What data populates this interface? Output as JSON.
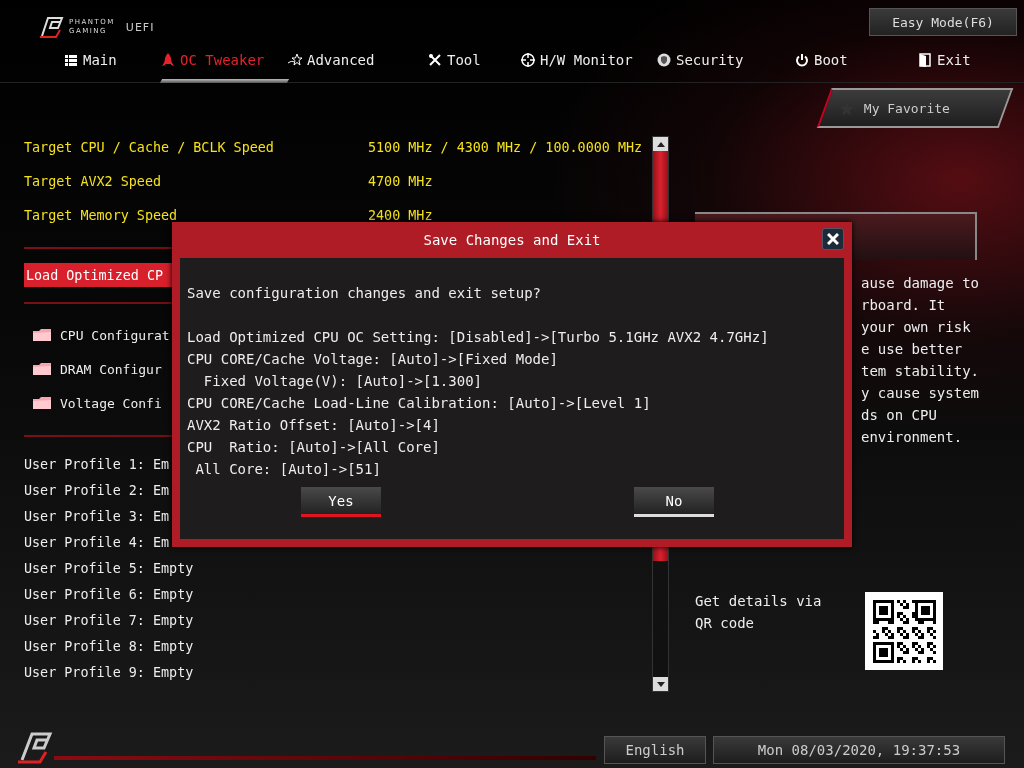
{
  "header": {
    "logo_line1": "PHANTOM",
    "logo_line2": "GAMING",
    "logo_suffix": "UEFI",
    "easy_mode_button": "Easy Mode(F6)"
  },
  "tabs": [
    {
      "label": "Main",
      "selected": false
    },
    {
      "label": "OC Tweaker",
      "selected": true
    },
    {
      "label": "Advanced",
      "selected": false
    },
    {
      "label": "Tool",
      "selected": false
    },
    {
      "label": "H/W Monitor",
      "selected": false
    },
    {
      "label": "Security",
      "selected": false
    },
    {
      "label": "Boot",
      "selected": false
    },
    {
      "label": "Exit",
      "selected": false
    }
  ],
  "favorite_button": "My Favorite",
  "settings": [
    {
      "kind": "info",
      "label": "Target CPU / Cache / BCLK Speed",
      "value": "5100 MHz / 4300 MHz / 100.0000 MHz"
    },
    {
      "kind": "info",
      "label": "Target AVX2 Speed",
      "value": "4700 MHz"
    },
    {
      "kind": "info",
      "label": "Target Memory Speed",
      "value": "2400 MHz"
    },
    {
      "kind": "divider"
    },
    {
      "kind": "action",
      "label": "Load Optimized CP",
      "selected": true
    },
    {
      "kind": "divider"
    },
    {
      "kind": "folder",
      "label": "CPU Configurat"
    },
    {
      "kind": "folder",
      "label": "DRAM Configur"
    },
    {
      "kind": "folder",
      "label": "Voltage Confi"
    },
    {
      "kind": "divider"
    },
    {
      "kind": "profile",
      "label": "User Profile 1: Em"
    },
    {
      "kind": "profile",
      "label": "User Profile 2: Em"
    },
    {
      "kind": "profile",
      "label": "User Profile 3: Em"
    },
    {
      "kind": "profile",
      "label": "User Profile 4: Em"
    },
    {
      "kind": "profile",
      "label": "User Profile 5: Empty"
    },
    {
      "kind": "profile",
      "label": "User Profile 6: Empty"
    },
    {
      "kind": "profile",
      "label": "User Profile 7: Empty"
    },
    {
      "kind": "profile",
      "label": "User Profile 8: Empty"
    },
    {
      "kind": "profile",
      "label": "User Profile 9: Empty"
    }
  ],
  "description": {
    "lines": [
      "ause damage to",
      "rboard. It",
      "your own risk",
      "e use better",
      "tem stability.",
      "y cause system",
      "ds on CPU",
      "environment."
    ],
    "qr_label": "Get details via QR code"
  },
  "dialog": {
    "title": "Save Changes and Exit",
    "question": "Save configuration changes and exit setup?",
    "changes": [
      "Load Optimized CPU OC Setting: [Disabled]->[Turbo 5.1GHz AVX2 4.7GHz]",
      "CPU CORE/Cache Voltage: [Auto]->[Fixed Mode]",
      "  Fixed Voltage(V): [Auto]->[1.300]",
      "CPU CORE/Cache Load-Line Calibration: [Auto]->[Level 1]",
      "AVX2 Ratio Offset: [Auto]->[4]",
      "CPU  Ratio: [Auto]->[All Core]",
      " All Core: [Auto]->[51]"
    ],
    "buttons": [
      {
        "label": "Yes",
        "selected": true
      },
      {
        "label": "No",
        "selected": false
      }
    ]
  },
  "footer": {
    "language": "English",
    "datetime": "Mon 08/03/2020, 19:37:53"
  }
}
